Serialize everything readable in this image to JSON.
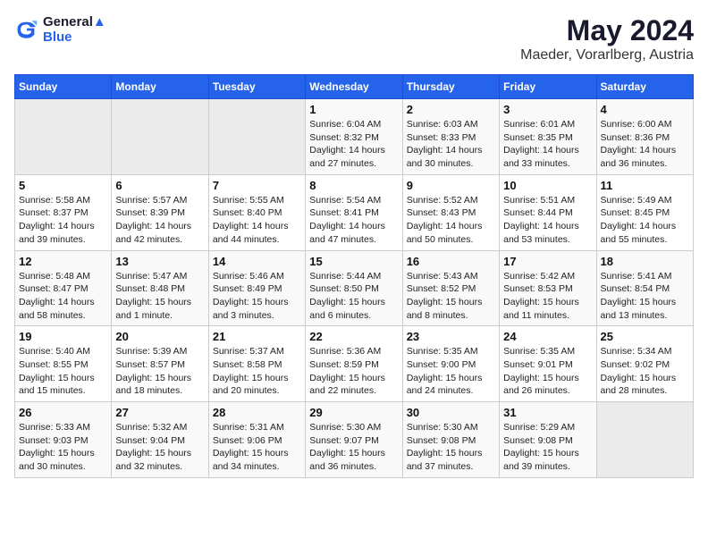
{
  "header": {
    "logo_line1": "General",
    "logo_line2": "Blue",
    "title": "May 2024",
    "subtitle": "Maeder, Vorarlberg, Austria"
  },
  "weekdays": [
    "Sunday",
    "Monday",
    "Tuesday",
    "Wednesday",
    "Thursday",
    "Friday",
    "Saturday"
  ],
  "weeks": [
    [
      {
        "day": "",
        "info": "",
        "empty": true
      },
      {
        "day": "",
        "info": "",
        "empty": true
      },
      {
        "day": "",
        "info": "",
        "empty": true
      },
      {
        "day": "1",
        "info": "Sunrise: 6:04 AM\nSunset: 8:32 PM\nDaylight: 14 hours\nand 27 minutes.",
        "empty": false
      },
      {
        "day": "2",
        "info": "Sunrise: 6:03 AM\nSunset: 8:33 PM\nDaylight: 14 hours\nand 30 minutes.",
        "empty": false
      },
      {
        "day": "3",
        "info": "Sunrise: 6:01 AM\nSunset: 8:35 PM\nDaylight: 14 hours\nand 33 minutes.",
        "empty": false
      },
      {
        "day": "4",
        "info": "Sunrise: 6:00 AM\nSunset: 8:36 PM\nDaylight: 14 hours\nand 36 minutes.",
        "empty": false
      }
    ],
    [
      {
        "day": "5",
        "info": "Sunrise: 5:58 AM\nSunset: 8:37 PM\nDaylight: 14 hours\nand 39 minutes.",
        "empty": false
      },
      {
        "day": "6",
        "info": "Sunrise: 5:57 AM\nSunset: 8:39 PM\nDaylight: 14 hours\nand 42 minutes.",
        "empty": false
      },
      {
        "day": "7",
        "info": "Sunrise: 5:55 AM\nSunset: 8:40 PM\nDaylight: 14 hours\nand 44 minutes.",
        "empty": false
      },
      {
        "day": "8",
        "info": "Sunrise: 5:54 AM\nSunset: 8:41 PM\nDaylight: 14 hours\nand 47 minutes.",
        "empty": false
      },
      {
        "day": "9",
        "info": "Sunrise: 5:52 AM\nSunset: 8:43 PM\nDaylight: 14 hours\nand 50 minutes.",
        "empty": false
      },
      {
        "day": "10",
        "info": "Sunrise: 5:51 AM\nSunset: 8:44 PM\nDaylight: 14 hours\nand 53 minutes.",
        "empty": false
      },
      {
        "day": "11",
        "info": "Sunrise: 5:49 AM\nSunset: 8:45 PM\nDaylight: 14 hours\nand 55 minutes.",
        "empty": false
      }
    ],
    [
      {
        "day": "12",
        "info": "Sunrise: 5:48 AM\nSunset: 8:47 PM\nDaylight: 14 hours\nand 58 minutes.",
        "empty": false
      },
      {
        "day": "13",
        "info": "Sunrise: 5:47 AM\nSunset: 8:48 PM\nDaylight: 15 hours\nand 1 minute.",
        "empty": false
      },
      {
        "day": "14",
        "info": "Sunrise: 5:46 AM\nSunset: 8:49 PM\nDaylight: 15 hours\nand 3 minutes.",
        "empty": false
      },
      {
        "day": "15",
        "info": "Sunrise: 5:44 AM\nSunset: 8:50 PM\nDaylight: 15 hours\nand 6 minutes.",
        "empty": false
      },
      {
        "day": "16",
        "info": "Sunrise: 5:43 AM\nSunset: 8:52 PM\nDaylight: 15 hours\nand 8 minutes.",
        "empty": false
      },
      {
        "day": "17",
        "info": "Sunrise: 5:42 AM\nSunset: 8:53 PM\nDaylight: 15 hours\nand 11 minutes.",
        "empty": false
      },
      {
        "day": "18",
        "info": "Sunrise: 5:41 AM\nSunset: 8:54 PM\nDaylight: 15 hours\nand 13 minutes.",
        "empty": false
      }
    ],
    [
      {
        "day": "19",
        "info": "Sunrise: 5:40 AM\nSunset: 8:55 PM\nDaylight: 15 hours\nand 15 minutes.",
        "empty": false
      },
      {
        "day": "20",
        "info": "Sunrise: 5:39 AM\nSunset: 8:57 PM\nDaylight: 15 hours\nand 18 minutes.",
        "empty": false
      },
      {
        "day": "21",
        "info": "Sunrise: 5:37 AM\nSunset: 8:58 PM\nDaylight: 15 hours\nand 20 minutes.",
        "empty": false
      },
      {
        "day": "22",
        "info": "Sunrise: 5:36 AM\nSunset: 8:59 PM\nDaylight: 15 hours\nand 22 minutes.",
        "empty": false
      },
      {
        "day": "23",
        "info": "Sunrise: 5:35 AM\nSunset: 9:00 PM\nDaylight: 15 hours\nand 24 minutes.",
        "empty": false
      },
      {
        "day": "24",
        "info": "Sunrise: 5:35 AM\nSunset: 9:01 PM\nDaylight: 15 hours\nand 26 minutes.",
        "empty": false
      },
      {
        "day": "25",
        "info": "Sunrise: 5:34 AM\nSunset: 9:02 PM\nDaylight: 15 hours\nand 28 minutes.",
        "empty": false
      }
    ],
    [
      {
        "day": "26",
        "info": "Sunrise: 5:33 AM\nSunset: 9:03 PM\nDaylight: 15 hours\nand 30 minutes.",
        "empty": false
      },
      {
        "day": "27",
        "info": "Sunrise: 5:32 AM\nSunset: 9:04 PM\nDaylight: 15 hours\nand 32 minutes.",
        "empty": false
      },
      {
        "day": "28",
        "info": "Sunrise: 5:31 AM\nSunset: 9:06 PM\nDaylight: 15 hours\nand 34 minutes.",
        "empty": false
      },
      {
        "day": "29",
        "info": "Sunrise: 5:30 AM\nSunset: 9:07 PM\nDaylight: 15 hours\nand 36 minutes.",
        "empty": false
      },
      {
        "day": "30",
        "info": "Sunrise: 5:30 AM\nSunset: 9:08 PM\nDaylight: 15 hours\nand 37 minutes.",
        "empty": false
      },
      {
        "day": "31",
        "info": "Sunrise: 5:29 AM\nSunset: 9:08 PM\nDaylight: 15 hours\nand 39 minutes.",
        "empty": false
      },
      {
        "day": "",
        "info": "",
        "empty": true
      }
    ]
  ]
}
